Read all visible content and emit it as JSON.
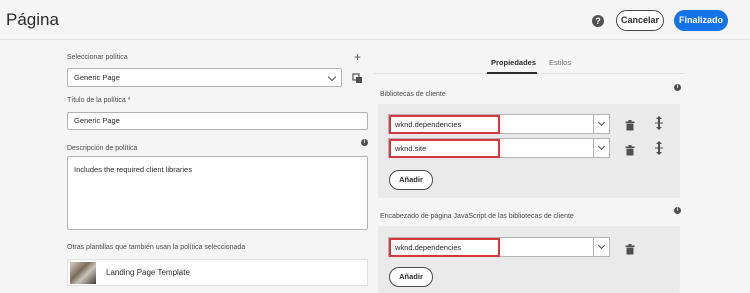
{
  "header": {
    "title": "Página",
    "help_icon": "help-icon",
    "cancel_label": "Cancelar",
    "done_label": "Finalizado",
    "accent_color": "#1473e6"
  },
  "left": {
    "select_policy_label": "Seleccionar política",
    "select_policy_value": "Generic Page",
    "policy_title_label": "Título de la política *",
    "policy_title_value": "Generic Page",
    "policy_description_label": "Descripción de política",
    "policy_description_value": "Includes the required client libraries",
    "other_templates_label": "Otras plantillas que también usan la política seleccionada",
    "template_name": "Landing Page Template"
  },
  "right": {
    "tabs": [
      {
        "label": "Propiedades",
        "active": true
      },
      {
        "label": "Estilos",
        "active": false
      }
    ],
    "client_libs_label": "Bibliotecas de cliente",
    "client_libs": [
      "wknd.dependencies",
      "wknd.site"
    ],
    "add_label": "Añadir",
    "js_head_label": "Encabezado de página JavaScript de las bibliotecas de cliente",
    "js_head_libs": [
      "wknd.dependencies"
    ],
    "add_label_2": "Añadir"
  }
}
